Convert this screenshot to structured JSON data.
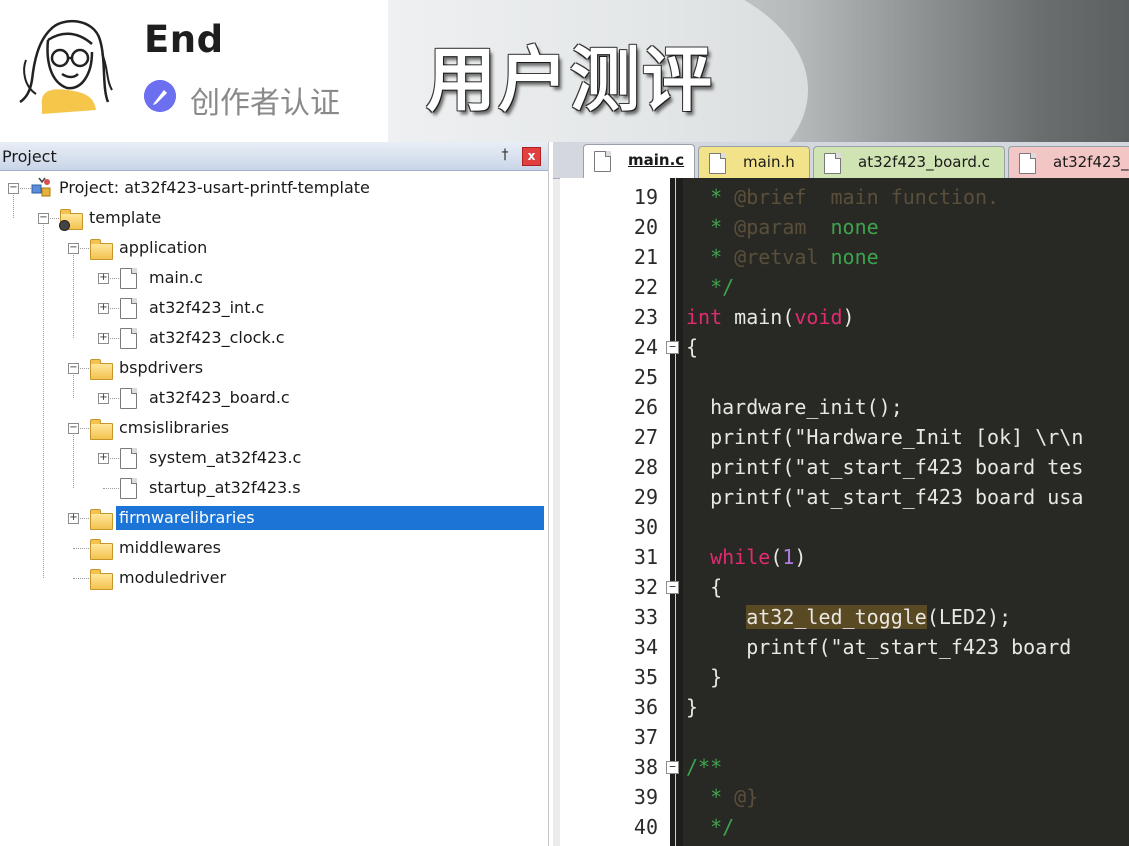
{
  "banner": {
    "author_name": "End",
    "badge_text": "创作者认证",
    "title": "用户测评"
  },
  "project_panel": {
    "title": "Project",
    "pin_glyph": "†",
    "close_glyph": "x",
    "tree": [
      {
        "label": "Project: at32f423-usart-printf-template",
        "icon": "project-icon",
        "level": 0,
        "expander": "-"
      },
      {
        "label": "template",
        "icon": "folder-target-icon",
        "level": 1,
        "expander": "-"
      },
      {
        "label": "application",
        "icon": "folder-open-icon",
        "level": 2,
        "expander": "-"
      },
      {
        "label": "main.c",
        "icon": "file-icon",
        "level": 3,
        "expander": "+"
      },
      {
        "label": "at32f423_int.c",
        "icon": "file-icon",
        "level": 3,
        "expander": "+"
      },
      {
        "label": "at32f423_clock.c",
        "icon": "file-icon",
        "level": 3,
        "expander": "+"
      },
      {
        "label": "bspdrivers",
        "icon": "folder-open-icon",
        "level": 2,
        "expander": "-"
      },
      {
        "label": "at32f423_board.c",
        "icon": "file-icon",
        "level": 3,
        "expander": "+"
      },
      {
        "label": "cmsislibraries",
        "icon": "folder-open-icon",
        "level": 2,
        "expander": "-"
      },
      {
        "label": "system_at32f423.c",
        "icon": "file-icon",
        "level": 3,
        "expander": "+"
      },
      {
        "label": "startup_at32f423.s",
        "icon": "file-icon",
        "level": 3,
        "expander": ""
      },
      {
        "label": "firmwarelibraries",
        "icon": "folder-icon",
        "level": 2,
        "expander": "+",
        "selected": true
      },
      {
        "label": "middlewares",
        "icon": "folder-icon",
        "level": 2,
        "expander": ""
      },
      {
        "label": "moduledriver",
        "icon": "folder-icon",
        "level": 2,
        "expander": ""
      }
    ]
  },
  "editor": {
    "tabs": [
      {
        "label": "main.c",
        "active": true,
        "color": "#e9eef6"
      },
      {
        "label": "main.h",
        "active": false,
        "color": "#f2e38a"
      },
      {
        "label": "at32f423_board.c",
        "active": false,
        "color": "#cfe3b3"
      },
      {
        "label": "at32f423_",
        "active": false,
        "color": "#f3c6c6"
      }
    ],
    "lines": [
      {
        "no": "19",
        "fold": "",
        "segments": [
          {
            "t": "  * ",
            "c": "c-comment"
          },
          {
            "t": "@brief",
            "c": "c-tag"
          },
          {
            "t": "  main function.",
            "c": "c-tag"
          }
        ]
      },
      {
        "no": "20",
        "fold": "",
        "segments": [
          {
            "t": "  * ",
            "c": "c-comment"
          },
          {
            "t": "@param",
            "c": "c-tag"
          },
          {
            "t": "  none",
            "c": "c-comment"
          }
        ]
      },
      {
        "no": "21",
        "fold": "",
        "segments": [
          {
            "t": "  * ",
            "c": "c-comment"
          },
          {
            "t": "@retval",
            "c": "c-tag"
          },
          {
            "t": " none",
            "c": "c-comment"
          }
        ]
      },
      {
        "no": "22",
        "fold": "",
        "segments": [
          {
            "t": "  */",
            "c": "c-comment"
          }
        ]
      },
      {
        "no": "23",
        "fold": "",
        "segments": [
          {
            "t": "int",
            "c": "c-kw"
          },
          {
            "t": " main(",
            "c": ""
          },
          {
            "t": "void",
            "c": "c-kw"
          },
          {
            "t": ")",
            "c": ""
          }
        ]
      },
      {
        "no": "24",
        "fold": "-",
        "segments": [
          {
            "t": "{",
            "c": ""
          }
        ]
      },
      {
        "no": "25",
        "fold": "",
        "segments": []
      },
      {
        "no": "26",
        "fold": "",
        "segments": [
          {
            "t": "  hardware_init();",
            "c": ""
          }
        ]
      },
      {
        "no": "27",
        "fold": "",
        "segments": [
          {
            "t": "  printf(\"Hardware_Init [ok] \\r\\n",
            "c": ""
          }
        ]
      },
      {
        "no": "28",
        "fold": "",
        "segments": [
          {
            "t": "  printf(\"at_start_f423 board tes",
            "c": ""
          }
        ]
      },
      {
        "no": "29",
        "fold": "",
        "segments": [
          {
            "t": "  printf(\"at_start_f423 board usa",
            "c": ""
          }
        ]
      },
      {
        "no": "30",
        "fold": "",
        "segments": []
      },
      {
        "no": "31",
        "fold": "",
        "segments": [
          {
            "t": "  ",
            "c": ""
          },
          {
            "t": "while",
            "c": "c-kw"
          },
          {
            "t": "(",
            "c": ""
          },
          {
            "t": "1",
            "c": "c-num"
          },
          {
            "t": ")",
            "c": ""
          }
        ]
      },
      {
        "no": "32",
        "fold": "-",
        "segments": [
          {
            "t": "  {",
            "c": ""
          }
        ]
      },
      {
        "no": "33",
        "fold": "",
        "segments": [
          {
            "t": "     ",
            "c": ""
          },
          {
            "t": "at32_led_toggle",
            "c": "c-hl"
          },
          {
            "t": "(LED2);",
            "c": ""
          }
        ]
      },
      {
        "no": "34",
        "fold": "",
        "segments": [
          {
            "t": "     printf(\"at_start_f423 board ",
            "c": ""
          }
        ]
      },
      {
        "no": "35",
        "fold": "",
        "segments": [
          {
            "t": "  }",
            "c": ""
          }
        ]
      },
      {
        "no": "36",
        "fold": "",
        "segments": [
          {
            "t": "}",
            "c": ""
          }
        ]
      },
      {
        "no": "37",
        "fold": "",
        "segments": []
      },
      {
        "no": "38",
        "fold": "-",
        "segments": [
          {
            "t": "/**",
            "c": "c-comment"
          }
        ]
      },
      {
        "no": "39",
        "fold": "",
        "segments": [
          {
            "t": "  * ",
            "c": "c-comment"
          },
          {
            "t": "@}",
            "c": "c-tag"
          }
        ]
      },
      {
        "no": "40",
        "fold": "",
        "segments": [
          {
            "t": "  */",
            "c": "c-comment"
          }
        ]
      }
    ]
  }
}
